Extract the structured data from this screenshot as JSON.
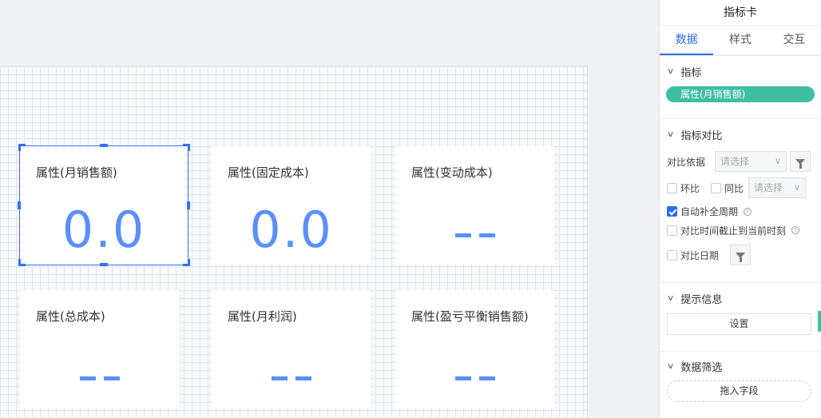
{
  "panel": {
    "title": "指标卡",
    "tabs": [
      "数据",
      "样式",
      "交互"
    ],
    "sections": {
      "metric": {
        "title": "指标",
        "field": "属性(月销售额)"
      },
      "compare": {
        "title": "指标对比",
        "basis_label": "对比依据",
        "basis_placeholder": "请选择",
        "ring_label": "环比",
        "yoy_label": "同比",
        "yoy_placeholder": "请选择",
        "auto_full_label": "自动补全周期",
        "cutoff_label": "对比时间截止到当前时刻",
        "date_label": "对比日期"
      },
      "tooltip": {
        "title": "提示信息",
        "button": "设置"
      },
      "filter": {
        "title": "数据筛选",
        "button": "拖入字段"
      }
    }
  },
  "cards": [
    {
      "title": "属性(月销售额)",
      "value": "0.0"
    },
    {
      "title": "属性(固定成本)",
      "value": "0.0"
    },
    {
      "title": "属性(变动成本)",
      "value": "--"
    },
    {
      "title": "属性(总成本)",
      "value": "--"
    },
    {
      "title": "属性(月利润)",
      "value": "--"
    },
    {
      "title": "属性(盈亏平衡销售额)",
      "value": "--"
    }
  ],
  "colors": {
    "accent": "#2c6bf2",
    "value": "#5b8ff9",
    "pill": "#3fbfa2"
  }
}
